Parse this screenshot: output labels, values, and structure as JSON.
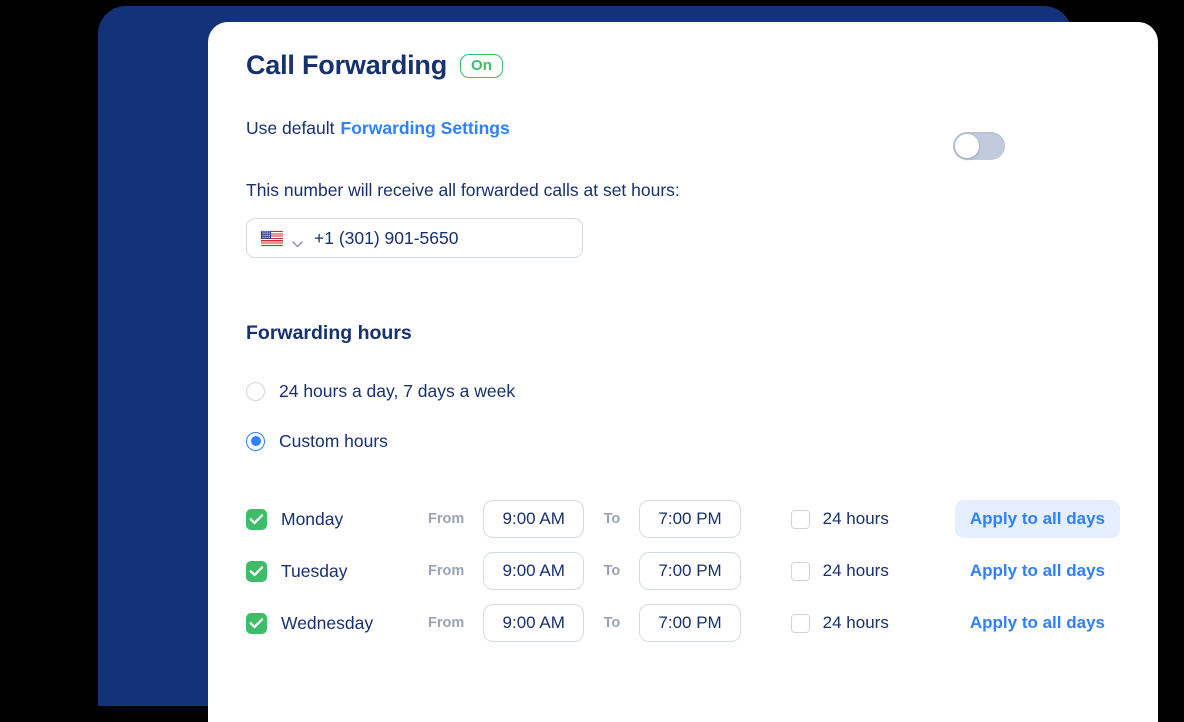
{
  "header": {
    "title": "Call Forwarding",
    "status_badge": "On"
  },
  "default_setting": {
    "text": "Use default",
    "link_label": "Forwarding Settings",
    "toggle_state": "off"
  },
  "description": "This number will receive all forwarded calls at set hours:",
  "phone": {
    "country_flag": "us-flag-icon",
    "dropdown_icon": "chevron-down-icon",
    "value": "+1 (301) 901-5650"
  },
  "forwarding_hours": {
    "section_title": "Forwarding hours",
    "options": [
      {
        "label": "24 hours a day, 7 days a week",
        "selected": false
      },
      {
        "label": "Custom hours",
        "selected": true
      }
    ]
  },
  "schedule": {
    "from_label": "From",
    "to_label": "To",
    "all_day_label": "24 hours",
    "apply_label": "Apply to all days",
    "rows": [
      {
        "day": "Monday",
        "enabled": true,
        "from": "9:00 AM",
        "to": "7:00 PM",
        "all_day": false,
        "apply_hover": true
      },
      {
        "day": "Tuesday",
        "enabled": true,
        "from": "9:00 AM",
        "to": "7:00 PM",
        "all_day": false,
        "apply_hover": false
      },
      {
        "day": "Wednesday",
        "enabled": true,
        "from": "9:00 AM",
        "to": "7:00 PM",
        "all_day": false,
        "apply_hover": false
      }
    ]
  },
  "colors": {
    "navy": "#17306e",
    "blue": "#2f80ff",
    "green": "#3fbc68",
    "frame_navy": "#13327a",
    "apply_hover_bg": "#e6efff"
  }
}
